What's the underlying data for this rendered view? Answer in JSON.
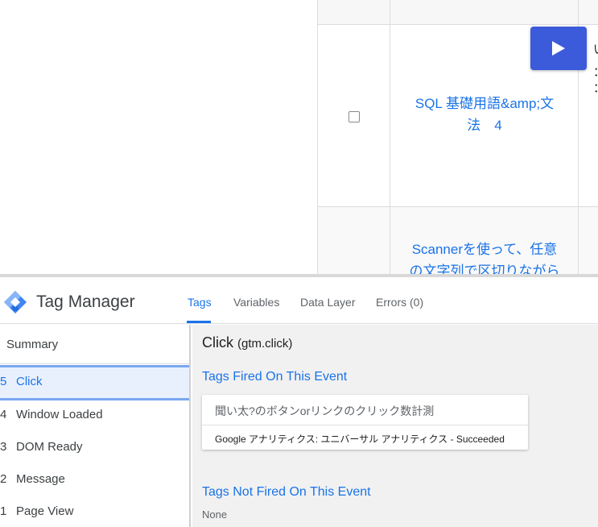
{
  "page": {
    "rows": [
      {
        "title": "SQL 基礎用語&amp;文\n法　4"
      },
      {
        "title": "Scannerを使って、任意\nの文字列で区切りながら"
      }
    ],
    "play_label": "▶",
    "edge_text": [
      "い",
      "：",
      "："
    ]
  },
  "gtm": {
    "title": "Tag Manager",
    "tabs": [
      {
        "label": "Tags",
        "active": true
      },
      {
        "label": "Variables",
        "active": false
      },
      {
        "label": "Data Layer",
        "active": false
      },
      {
        "label": "Errors (0)",
        "active": false
      }
    ],
    "sidebar": {
      "summary": "Summary",
      "events": [
        {
          "num": "5",
          "label": "Click",
          "selected": true
        },
        {
          "num": "4",
          "label": "Window Loaded",
          "selected": false
        },
        {
          "num": "3",
          "label": "DOM Ready",
          "selected": false
        },
        {
          "num": "2",
          "label": "Message",
          "selected": false
        },
        {
          "num": "1",
          "label": "Page View",
          "selected": false
        }
      ]
    },
    "main": {
      "event_title": "Click",
      "event_sub": "(gtm.click)",
      "fired_heading": "Tags Fired On This Event",
      "fired_tags": [
        {
          "name": "聞い太?のボタンorリンクのクリック数計測",
          "status": "Google アナリティクス: ユニバーサル アナリティクス - Succeeded"
        }
      ],
      "not_fired_heading": "Tags Not Fired On This Event",
      "not_fired_value": "None"
    },
    "colors": {
      "accent": "#1a73e8",
      "selected_bg": "#e8f0fe",
      "play_button": "#3b5bdb"
    }
  }
}
